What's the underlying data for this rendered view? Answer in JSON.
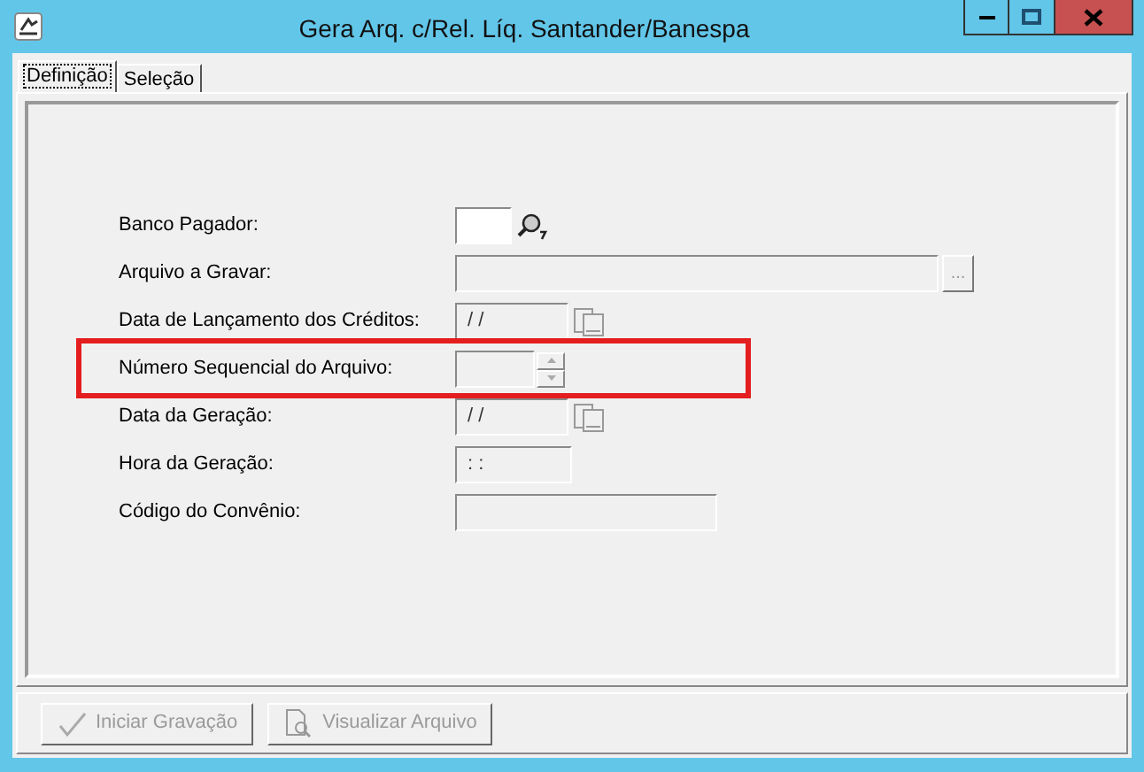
{
  "window": {
    "title": "Gera Arq. c/Rel. Líq. Santander/Banespa"
  },
  "tabs": [
    {
      "label": "Definição",
      "selected": true
    },
    {
      "label": "Seleção",
      "selected": false
    }
  ],
  "fields": [
    {
      "label": "Banco Pagador:",
      "kind": "lookup",
      "disabled": false
    },
    {
      "label": "Arquivo a Gravar:",
      "kind": "browse",
      "disabled": true,
      "button": "..."
    },
    {
      "label": "Data de Lançamento dos Créditos:",
      "kind": "date",
      "disabled": true,
      "value": "/ /"
    },
    {
      "label": "Número Sequencial do Arquivo:",
      "kind": "spin",
      "disabled": true,
      "highlighted": true
    },
    {
      "label": "Data da Geração:",
      "kind": "date",
      "disabled": true,
      "value": "/ /"
    },
    {
      "label": "Hora da Geração:",
      "kind": "time",
      "disabled": true,
      "value": ": :"
    },
    {
      "label": "Código do Convênio:",
      "kind": "text",
      "disabled": true
    }
  ],
  "buttons": [
    {
      "label": "Iniciar Gravação",
      "kind": "check",
      "disabled": true
    },
    {
      "label": "Visualizar Arquivo",
      "kind": "preview",
      "disabled": true
    }
  ]
}
